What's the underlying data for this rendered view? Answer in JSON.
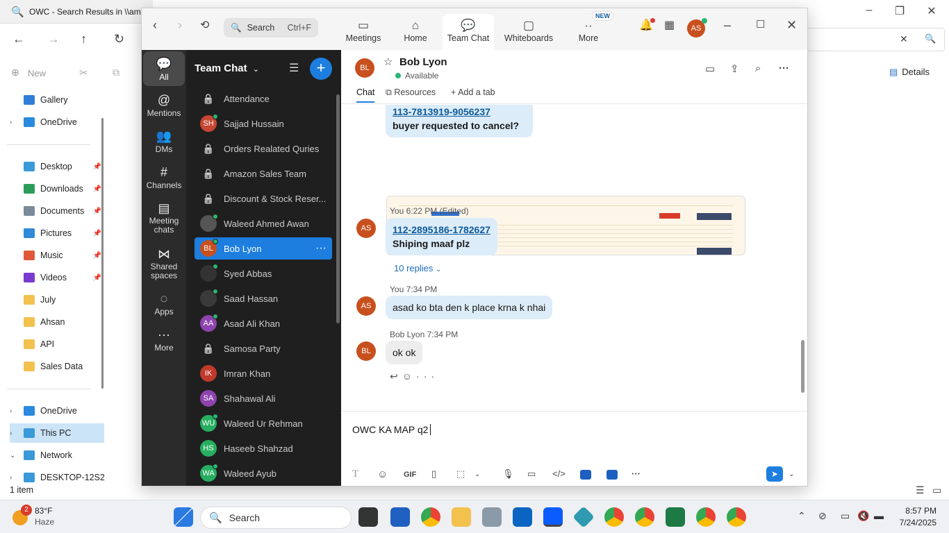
{
  "explorer": {
    "tab_title": "OWC - Search Results in \\\\am",
    "new_label": "New",
    "details_label": "Details",
    "nav_items": [
      {
        "label": "Gallery",
        "color": "#2f7fd8",
        "chev": ""
      },
      {
        "label": "OneDrive",
        "color": "#2a8ae0",
        "chev": "›"
      },
      {
        "label": "Desktop",
        "color": "#3a9ad9",
        "pin": true
      },
      {
        "label": "Downloads",
        "color": "#2c9c5a",
        "pin": true
      },
      {
        "label": "Documents",
        "color": "#7a8a9a",
        "pin": true
      },
      {
        "label": "Pictures",
        "color": "#2f8ad8",
        "pin": true
      },
      {
        "label": "Music",
        "color": "#e05a3a",
        "pin": true
      },
      {
        "label": "Videos",
        "color": "#7a3ad0",
        "pin": true
      },
      {
        "label": "July",
        "color": "#f2c14e"
      },
      {
        "label": "Ahsan",
        "color": "#f2c14e"
      },
      {
        "label": "API",
        "color": "#f2c14e"
      },
      {
        "label": "Sales Data",
        "color": "#f2c14e"
      },
      {
        "label": "OneDrive",
        "color": "#2a8ae0",
        "chev": "›"
      },
      {
        "label": "This PC",
        "color": "#3a9ad9",
        "chev": "›",
        "sel": true
      },
      {
        "label": "Network",
        "color": "#3a9ad9",
        "chev": "⌄"
      },
      {
        "label": "DESKTOP-12S2",
        "color": "#3a9ad9",
        "chev": "›"
      }
    ],
    "status": "1 item"
  },
  "teams": {
    "search_placeholder": "Search",
    "search_shortcut": "Ctrl+F",
    "nav": [
      "Meetings",
      "Home",
      "Team Chat",
      "Whiteboards",
      "More"
    ],
    "new_badge": "NEW",
    "user_initials": "AS",
    "rail": [
      "All",
      "Mentions",
      "DMs",
      "Channels",
      "Meeting chats",
      "Shared spaces",
      "Apps",
      "More"
    ],
    "list_title": "Team Chat",
    "chats": [
      {
        "name": "Attendance",
        "type": "channel"
      },
      {
        "name": "Sajjad Hussain",
        "initials": "SH",
        "color": "#c74634",
        "online": true
      },
      {
        "name": "Orders Realated Quries",
        "type": "channel"
      },
      {
        "name": "Amazon Sales Team",
        "type": "channel"
      },
      {
        "name": "Discount & Stock Reser...",
        "type": "channel"
      },
      {
        "name": "Waleed Ahmed Awan",
        "initials": "",
        "color": "#555",
        "online": true
      },
      {
        "name": "Bob Lyon",
        "initials": "BL",
        "color": "#c8501e",
        "online": true,
        "selected": true
      },
      {
        "name": "Syed Abbas",
        "initials": "",
        "color": "#333",
        "online": true
      },
      {
        "name": "Saad Hassan",
        "initials": "",
        "color": "#3a3a3a",
        "online": true
      },
      {
        "name": "Asad Ali Khan",
        "initials": "AA",
        "color": "#8e44ad",
        "online": true
      },
      {
        "name": "Samosa Party",
        "type": "channel"
      },
      {
        "name": "Imran Khan",
        "initials": "IK",
        "color": "#c0392b"
      },
      {
        "name": "Shahawal Ali",
        "initials": "SA",
        "color": "#8e44ad"
      },
      {
        "name": "Waleed Ur Rehman",
        "initials": "WU",
        "color": "#27ae60",
        "online": true
      },
      {
        "name": "Haseeb Shahzad",
        "initials": "HS",
        "color": "#27ae60"
      },
      {
        "name": "Waleed Ayub",
        "initials": "WA",
        "color": "#27ae60",
        "online": true
      }
    ],
    "contact": {
      "name": "Bob Lyon",
      "initials": "BL",
      "status": "Available"
    },
    "tabs": [
      "Chat",
      "Resources",
      "Add a tab"
    ],
    "messages": {
      "m1_link": "113-7813919-9056237",
      "m1_text": "buyer requested to cancel?",
      "m2_meta": "You 6:22 PM (Edited)",
      "m2_link": "112-2895186-1782627",
      "m2_text": "Shiping  maaf plz",
      "replies": "10 replies",
      "m3_meta": "You 7:34 PM",
      "m3_text": "asad ko bta den k place krna k nhai",
      "m4_meta": "Bob Lyon 7:34 PM",
      "m4_text": "ok ok"
    },
    "compose_text": "OWC KA MAP q2",
    "compose_tools": [
      "T",
      "☺",
      "GIF"
    ]
  },
  "taskbar": {
    "temp": "83°F",
    "weather": "Haze",
    "weather_badge": "2",
    "search": "Search",
    "time": "8:57 PM",
    "date": "7/24/2025"
  }
}
